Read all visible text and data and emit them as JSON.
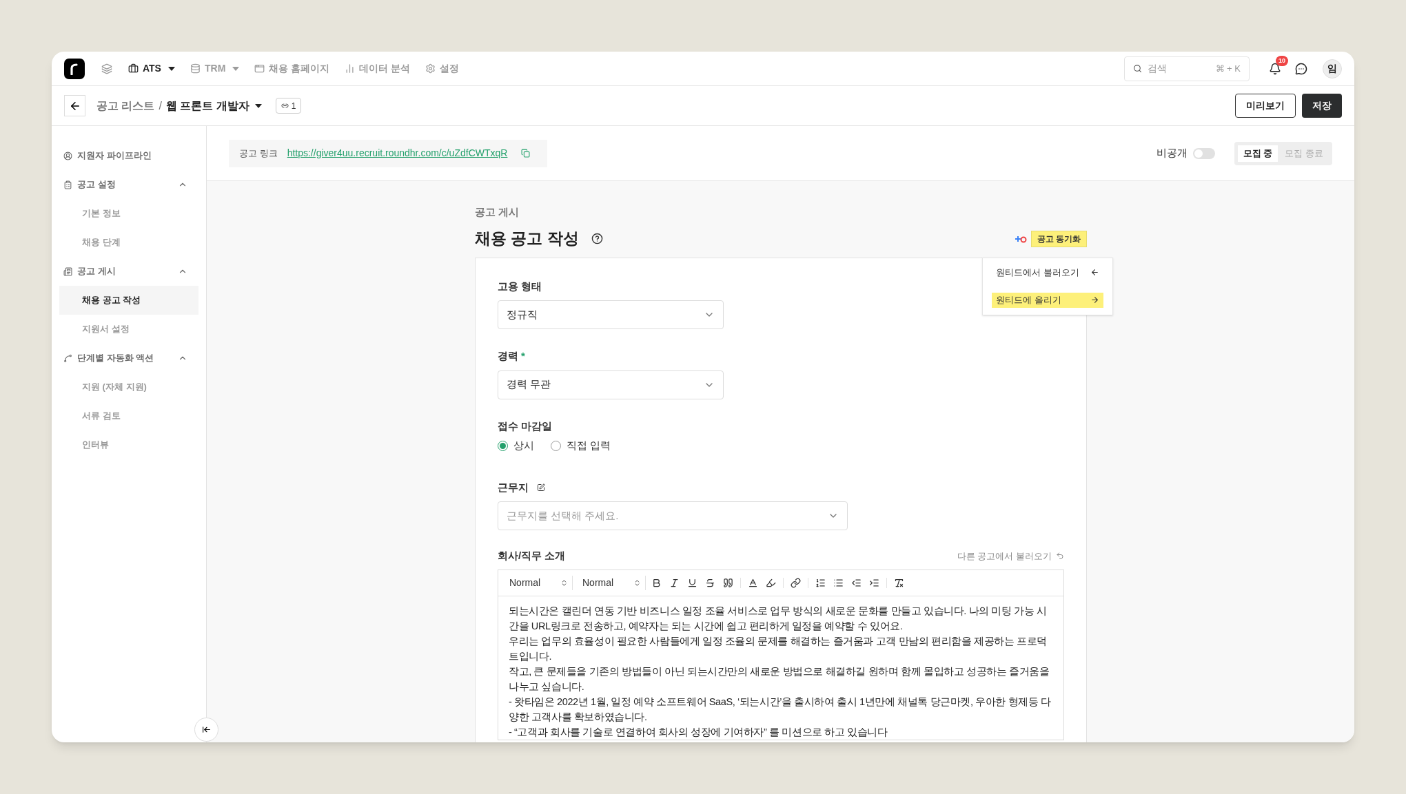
{
  "top_nav": {
    "items": [
      {
        "kind": "icon",
        "selected": false
      },
      {
        "kind": "menu",
        "label": "ATS",
        "dropdown": true,
        "selected": true
      },
      {
        "kind": "menu",
        "label": "TRM",
        "dropdown": true,
        "selected": false
      },
      {
        "kind": "menu",
        "label": "채용 홈페이지",
        "dropdown": false,
        "selected": false
      },
      {
        "kind": "menu",
        "label": "데이터 분석",
        "dropdown": false,
        "selected": false
      },
      {
        "kind": "menu",
        "label": "설정",
        "dropdown": false,
        "selected": false
      }
    ],
    "search": {
      "placeholder": "검색",
      "shortcut": "⌘ + K"
    },
    "notification_count": "10",
    "avatar": "임"
  },
  "breadcrumb": {
    "parent": "공고 리스트",
    "separator": "/",
    "current": "웹 프론트 개발자",
    "link_count": "1"
  },
  "header_buttons": [
    {
      "label": "미리보기",
      "kind": "outline"
    },
    {
      "label": "저장",
      "kind": "primary"
    }
  ],
  "sidebar": {
    "items": [
      {
        "label": "지원자 파이프라인",
        "selected": false
      },
      {
        "label": "공고 설정",
        "expanded": true,
        "selected": false,
        "children": [
          {
            "label": "기본 정보",
            "selected": false
          },
          {
            "label": "채용 단계",
            "selected": false
          }
        ]
      },
      {
        "label": "공고 게시",
        "expanded": true,
        "selected": false,
        "children": [
          {
            "label": "채용 공고 작성",
            "selected": true
          },
          {
            "label": "지원서 설정",
            "selected": false
          }
        ]
      },
      {
        "label": "단계별 자동화 액션",
        "expanded": true,
        "selected": false,
        "children": [
          {
            "label": "지원 (자체 지원)",
            "selected": false
          },
          {
            "label": "서류 검토",
            "selected": false
          },
          {
            "label": "인터뷰",
            "selected": false
          }
        ]
      }
    ]
  },
  "link_bar": {
    "label": "공고 링크",
    "url": "https://giver4uu.recruit.roundhr.com/c/uZdfCWTxqR"
  },
  "private_toggle": {
    "label": "비공개",
    "on": false
  },
  "status_tabs": [
    {
      "label": "모집 중",
      "selected": true
    },
    {
      "label": "모집 종료",
      "selected": false
    }
  ],
  "page": {
    "section": "공고 게시",
    "title": "채용 공고 작성"
  },
  "sync": {
    "label": "공고 동기화",
    "highlighted": true,
    "menu": [
      {
        "label": "원티드에서 불러오기",
        "kind": "import",
        "highlighted": false
      },
      {
        "label": "원티드에 올리기",
        "kind": "export",
        "highlighted": true
      }
    ]
  },
  "form": {
    "employment_type": {
      "label": "고용 형태",
      "value": "정규직"
    },
    "career": {
      "label": "경력",
      "required": true,
      "required_mark": "*",
      "value": "경력 무관"
    },
    "deadline": {
      "label": "접수 마감일",
      "options": [
        {
          "label": "상시",
          "selected": true
        },
        {
          "label": "직접 입력",
          "selected": false
        }
      ]
    },
    "location": {
      "label": "근무지",
      "placeholder": "근무지를 선택해 주세요."
    },
    "intro": {
      "label": "회사/직무 소개",
      "load_link": "다른 공고에서 불러오기",
      "toolbar_selects": [
        "Normal",
        "Normal"
      ],
      "paragraphs": [
        "되는시간은 캘린더 연동 기반 비즈니스 일정 조율 서비스로 업무 방식의 새로운 문화를 만들고 있습니다. 나의 미팅 가능 시간을 URL링크로 전송하고, 예약자는 되는 시간에 쉽고 편리하게 일정을 예약할 수 있어요.",
        "우리는 업무의 효율성이 필요한 사람들에게 일정 조율의 문제를 해결하는 즐거움과 고객 만남의 편리함을 제공하는 프로덕트입니다.",
        "작고, 큰 문제들을 기존의 방법들이 아닌 되는시간만의 새로운 방법으로 해결하길 원하며 함께 몰입하고 성공하는 즐거움을 나누고 싶습니다.",
        "- 왓타임은 2022년 1월, 일정 예약 소프트웨어 SaaS, ‘되는시간’을 출시하여 출시 1년만에 채널톡 당근마켓, 우아한 형제등 다양한 고객사를 확보하였습니다.",
        "- “고객과 회사를 기술로 연결하여 회사의 성장에 기여하자” 를 미션으로 하고 있습니다"
      ]
    }
  }
}
